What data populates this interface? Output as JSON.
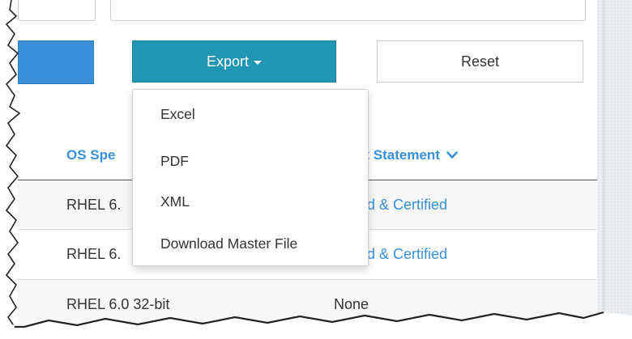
{
  "toolbar": {
    "export_label": "Export",
    "reset_label": "Reset"
  },
  "export_menu": {
    "items": [
      "Excel",
      "PDF",
      "XML",
      "Download Master File"
    ]
  },
  "table": {
    "headers": {
      "os": "OS Spe",
      "support": "port Statement"
    },
    "rows": [
      {
        "os": "RHEL 6.",
        "support": "ported & Certified"
      },
      {
        "os": "RHEL 6.",
        "support": "ported & Certified"
      },
      {
        "os": "RHEL 6.0 32-bit",
        "support": "None"
      }
    ]
  },
  "colors": {
    "export_button": "#2196b4",
    "primary_button": "#3a8fd9",
    "link": "#3a8fd9",
    "text": "#333333"
  },
  "icons": {
    "caret": "caret-down-icon",
    "sort": "chevron-down-icon"
  }
}
